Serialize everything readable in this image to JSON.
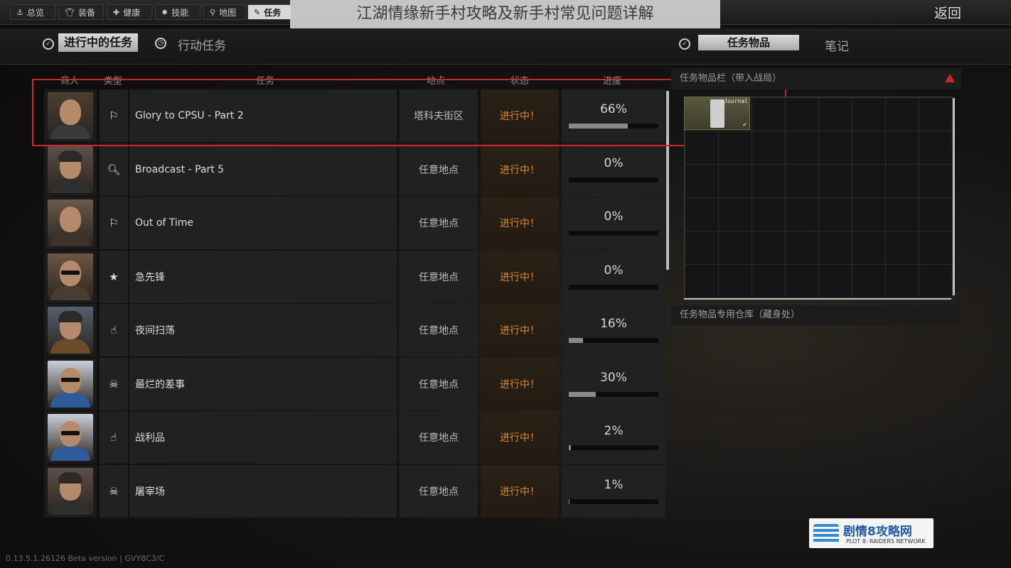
{
  "tabs": [
    {
      "label": "总览",
      "icon": "anchor-icon"
    },
    {
      "label": "装备",
      "icon": "shirt-icon"
    },
    {
      "label": "健康",
      "icon": "health-icon"
    },
    {
      "label": "技能",
      "icon": "skill-icon"
    },
    {
      "label": "地图",
      "icon": "map-pin-icon"
    },
    {
      "label": "任务",
      "icon": "task-icon",
      "active": true
    }
  ],
  "banner_title": "江湖情缘新手村攻略及新手村常见问题详解",
  "back_label": "返回",
  "subheader": {
    "active_quests": "进行中的任务",
    "action_quests": "行动任务",
    "quest_items": "任务物品",
    "notes": "笔记"
  },
  "columns": {
    "trader": "商人",
    "type": "类型",
    "task": "任务",
    "location": "地点",
    "status": "状态",
    "progress": "进度"
  },
  "quests": [
    {
      "name": "Glory to CPSU - Part 2",
      "type_icon": "exit-icon",
      "type_glyph": "⚐",
      "location": "塔科夫街区",
      "status": "进行中！",
      "progress": "66%",
      "fill": 0.66
    },
    {
      "name": "Broadcast - Part 5",
      "type_icon": "search-icon",
      "type_glyph": "🔍︎",
      "location": "任意地点",
      "status": "进行中！",
      "progress": "0%",
      "fill": 0
    },
    {
      "name": "Out of Time",
      "type_icon": "exit-icon",
      "type_glyph": "⚐",
      "location": "任意地点",
      "status": "进行中！",
      "progress": "0%",
      "fill": 0
    },
    {
      "name": "急先锋",
      "type_icon": "star-icon",
      "type_glyph": "★",
      "location": "任意地点",
      "status": "进行中！",
      "progress": "0%",
      "fill": 0
    },
    {
      "name": "夜间扫荡",
      "type_icon": "hand-icon",
      "type_glyph": "☝",
      "location": "任意地点",
      "status": "进行中！",
      "progress": "16%",
      "fill": 0.16
    },
    {
      "name": "最烂的差事",
      "type_icon": "skull-icon",
      "type_glyph": "☠",
      "location": "任意地点",
      "status": "进行中！",
      "progress": "30%",
      "fill": 0.3
    },
    {
      "name": "战利品",
      "type_icon": "hand-icon",
      "type_glyph": "☝",
      "location": "任意地点",
      "status": "进行中！",
      "progress": "2%",
      "fill": 0.02
    },
    {
      "name": "屠宰场",
      "type_icon": "skull-icon",
      "type_glyph": "☠",
      "location": "任意地点",
      "status": "进行中！",
      "progress": "1%",
      "fill": 0.01
    }
  ],
  "right_panel": {
    "items_title": "任务物品栏（带入战局）",
    "item_label": "Journal",
    "stash_title": "任务物品专用仓库（藏身处）"
  },
  "version": "0.13.5.1.26126 Beta version | GVY8C3/C",
  "watermark": {
    "title": "剧情8攻略网",
    "subtitle": "PLOT 8: RAIDERS NETWORK"
  }
}
